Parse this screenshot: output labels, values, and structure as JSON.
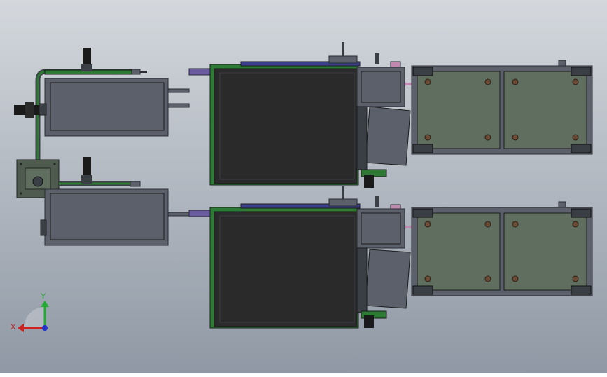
{
  "viewport": {
    "background_top": "#d4d8dd",
    "background_bottom": "#8f98a4"
  },
  "colors": {
    "frame_green": "#2d7a34",
    "frame_dark": "#1c1c1c",
    "panel_dark": "#2a2a2a",
    "housing": "#5b606b",
    "housing_stroke": "#2b2d33",
    "plate_green": "#5f6e5e",
    "hole_brown": "#6b4a35",
    "accent_purple": "#6a5aa0",
    "accent_pink": "#c08ab0",
    "motor_black": "#1a1a1a"
  },
  "triad": {
    "x_label": "X",
    "y_label": "Y",
    "x_color": "#cc2222",
    "y_color": "#22aa33",
    "z_color": "#2233cc"
  }
}
